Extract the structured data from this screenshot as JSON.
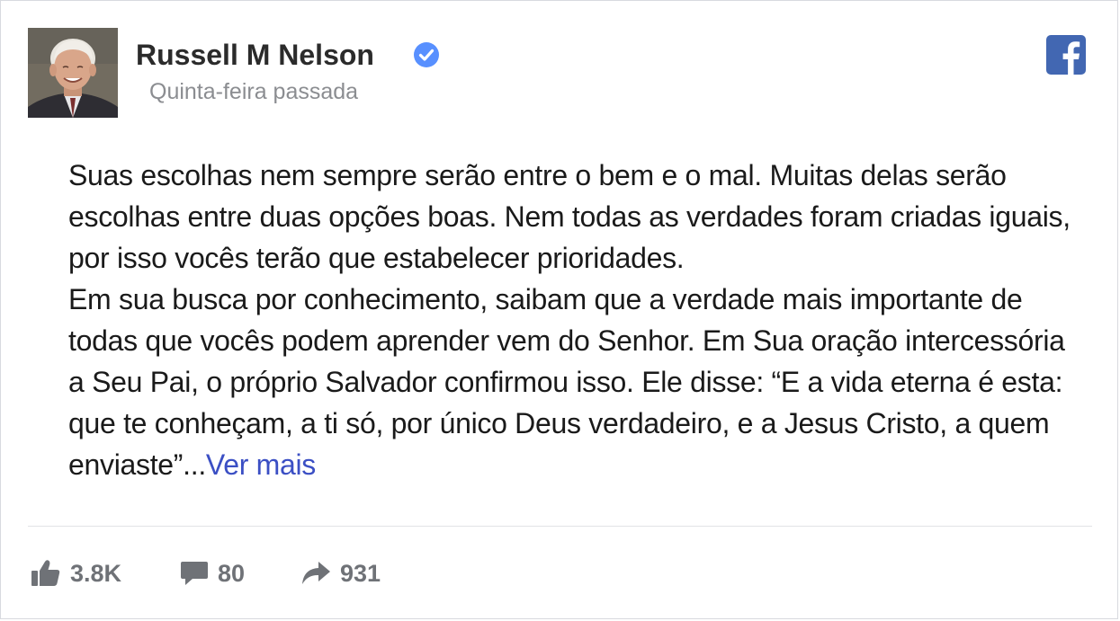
{
  "post": {
    "author": "Russell M Nelson",
    "timestamp": "Quinta-feira passada",
    "paragraph1": "Suas escolhas nem sempre serão entre o bem e o mal. Muitas delas serão escolhas entre duas opções boas. Nem todas as verdades foram criadas iguais, por isso vocês terão que estabelecer prioridades.",
    "paragraph2": "Em sua busca por conhecimento, saibam que a verdade mais importante de todas que vocês podem aprender vem do Senhor. Em Sua oração intercessória a Seu Pai, o próprio Salvador confirmou isso. Ele disse: “E a vida eterna é esta: que te conheçam, a ti só, por único Deus verdadeiro, e a Jesus Cristo, a quem enviaste”...",
    "see_more": "Ver mais"
  },
  "stats": {
    "likes": "3.8K",
    "comments": "80",
    "shares": "931"
  },
  "icons": {
    "verified": "verified-badge-icon",
    "platform": "facebook-icon",
    "like": "thumbs-up-icon",
    "comment": "comment-icon",
    "share": "share-arrow-icon"
  },
  "colors": {
    "facebook_blue": "#4267b2",
    "verified_blue": "#5890ff",
    "link": "#3b4fc4",
    "stat_gray": "#6f7277"
  }
}
